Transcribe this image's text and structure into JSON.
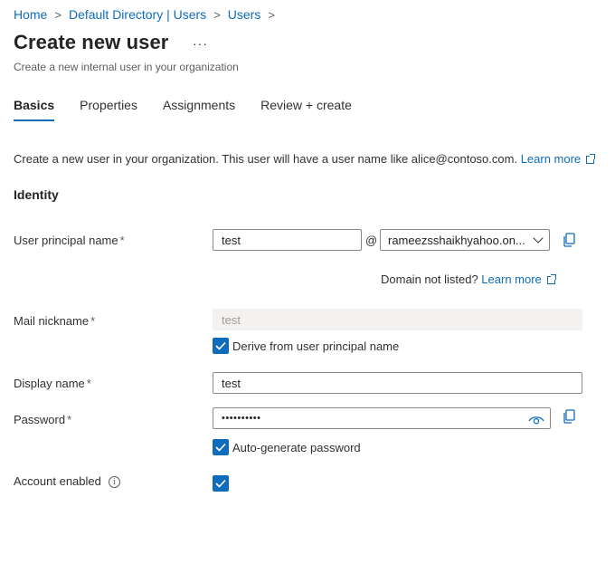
{
  "breadcrumb": {
    "items": [
      "Home",
      "Default Directory | Users",
      "Users"
    ],
    "separator": ">"
  },
  "header": {
    "title": "Create new user",
    "more_icon": "more-horizontal-icon",
    "more_glyph": "···",
    "subtitle": "Create a new internal user in your organization"
  },
  "tabs": [
    {
      "label": "Basics",
      "active": true
    },
    {
      "label": "Properties",
      "active": false
    },
    {
      "label": "Assignments",
      "active": false
    },
    {
      "label": "Review + create",
      "active": false
    }
  ],
  "intro": {
    "text": "Create a new user in your organization. This user will have a user name like alice@contoso.com.",
    "link": "Learn more"
  },
  "identity": {
    "heading": "Identity",
    "upn": {
      "label": "User principal name",
      "required_mark": "*",
      "value": "test",
      "at": "@",
      "domain_value": "rameezsshaikhyahoo.on...",
      "copy_icon": "copy-icon"
    },
    "domain_note": {
      "text": "Domain not listed?",
      "link": "Learn more"
    },
    "mail_nickname": {
      "label": "Mail nickname",
      "required_mark": "*",
      "value": "test",
      "derive_checkbox_label": "Derive from user principal name",
      "derive_checked": true
    },
    "display_name": {
      "label": "Display name",
      "required_mark": "*",
      "value": "test"
    },
    "password": {
      "label": "Password",
      "required_mark": "*",
      "value": "••••••••••",
      "reveal_icon": "eye-icon",
      "copy_icon": "copy-icon",
      "autogen_label": "Auto-generate password",
      "autogen_checked": true
    },
    "account_enabled": {
      "label": "Account enabled",
      "info_icon": "info-icon",
      "info_glyph": "i",
      "checked": true
    }
  },
  "colors": {
    "accent": "#0f6cbd",
    "text": "#323130",
    "disabled_bg": "#f3f2f1"
  }
}
